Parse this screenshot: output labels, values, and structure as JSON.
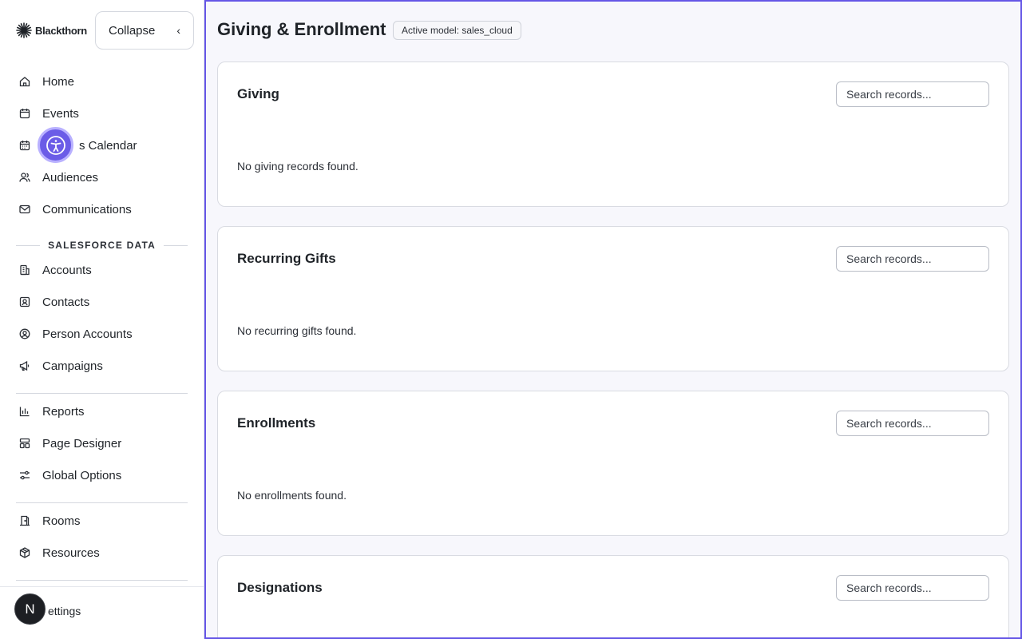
{
  "brand": {
    "name": "Blackthorn"
  },
  "sidebar": {
    "collapse_label": "Collapse",
    "items": [
      {
        "label": "Home",
        "icon": "home-icon"
      },
      {
        "label": "Events",
        "icon": "calendar-icon"
      },
      {
        "label": "s Calendar",
        "icon": "calendar-grid-icon"
      },
      {
        "label": "Audiences",
        "icon": "users-icon"
      },
      {
        "label": "Communications",
        "icon": "mail-icon"
      }
    ],
    "section_label": "SALESFORCE DATA",
    "data_items": [
      {
        "label": "Accounts",
        "icon": "building-icon"
      },
      {
        "label": "Contacts",
        "icon": "contact-card-icon"
      },
      {
        "label": "Person Accounts",
        "icon": "user-circle-icon"
      },
      {
        "label": "Campaigns",
        "icon": "megaphone-icon"
      }
    ],
    "tools": [
      {
        "label": "Reports",
        "icon": "bar-chart-icon"
      },
      {
        "label": "Page Designer",
        "icon": "layout-icon"
      },
      {
        "label": "Global Options",
        "icon": "sliders-icon"
      }
    ],
    "venue": [
      {
        "label": "Rooms",
        "icon": "door-icon"
      },
      {
        "label": "Resources",
        "icon": "box-icon"
      }
    ],
    "settings_label": "ettings",
    "avatar_initial": "N"
  },
  "header": {
    "title": "Giving & Enrollment",
    "badge": "Active model: sales_cloud"
  },
  "cards": [
    {
      "title": "Giving",
      "search_placeholder": "Search records...",
      "empty_text": "No giving records found."
    },
    {
      "title": "Recurring Gifts",
      "search_placeholder": "Search records...",
      "empty_text": "No recurring gifts found."
    },
    {
      "title": "Enrollments",
      "search_placeholder": "Search records...",
      "empty_text": "No enrollments found."
    },
    {
      "title": "Designations",
      "search_placeholder": "Search records...",
      "empty_text": ""
    }
  ],
  "colors": {
    "accent": "#6556e6",
    "a11y": "#6b5ce7"
  }
}
